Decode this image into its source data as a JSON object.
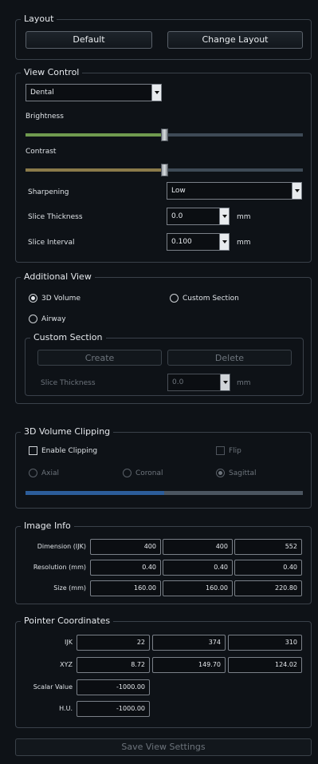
{
  "layout": {
    "title": "Layout",
    "default_label": "Default",
    "change_layout_label": "Change Layout"
  },
  "view_control": {
    "title": "View Control",
    "preset_selected": "Dental",
    "brightness_label": "Brightness",
    "brightness_level": 0.5,
    "contrast_label": "Contrast",
    "contrast_level": 0.5,
    "sharpening_label": "Sharpening",
    "sharpening_selected": "Low",
    "slice_thickness_label": "Slice Thickness",
    "slice_thickness_value": "0.0",
    "slice_thickness_unit": "mm",
    "slice_interval_label": "Slice Interval",
    "slice_interval_value": "0.100",
    "slice_interval_unit": "mm",
    "colors": {
      "brightness_fill": "#6f9a4f",
      "contrast_fill": "#8a7a4a",
      "track": "#3e4a56"
    }
  },
  "additional_view": {
    "title": "Additional View",
    "volume_3d_label": "3D Volume",
    "custom_section_label": "Custom Section",
    "airway_label": "Airway",
    "selected": "3D Volume",
    "custom_section": {
      "title": "Custom Section",
      "create_label": "Create",
      "delete_label": "Delete",
      "slice_thickness_label": "Slice Thickness",
      "slice_thickness_value": "0.0",
      "slice_thickness_unit": "mm"
    }
  },
  "clipping": {
    "title": "3D Volume Clipping",
    "enable_label": "Enable Clipping",
    "flip_label": "Flip",
    "axial_label": "Axial",
    "coronal_label": "Coronal",
    "sagittal_label": "Sagittal",
    "selected_plane": "Sagittal",
    "level": 0.5,
    "colors": {
      "fill": "#2c5d9a",
      "track": "#4b5560"
    }
  },
  "image_info": {
    "title": "Image Info",
    "rows": [
      {
        "label": "Dimension (IJK)",
        "values": [
          "400",
          "400",
          "552"
        ]
      },
      {
        "label": "Resolution (mm)",
        "values": [
          "0.40",
          "0.40",
          "0.40"
        ]
      },
      {
        "label": "Size (mm)",
        "values": [
          "160.00",
          "160.00",
          "220.80"
        ]
      }
    ]
  },
  "pointer": {
    "title": "Pointer Coordinates",
    "ijk_label": "IJK",
    "ijk_values": [
      "22",
      "374",
      "310"
    ],
    "xyz_label": "XYZ",
    "xyz_values": [
      "8.72",
      "149.70",
      "124.02"
    ],
    "scalar_label": "Scalar Value",
    "scalar_value": "-1000.00",
    "hu_label": "H.U.",
    "hu_value": "-1000.00"
  },
  "footer": {
    "save_label": "Save View Settings"
  }
}
